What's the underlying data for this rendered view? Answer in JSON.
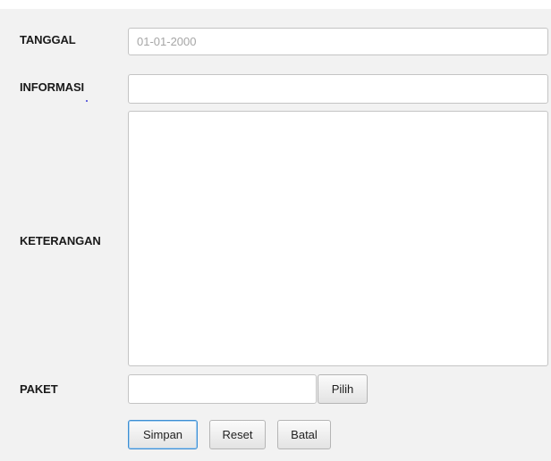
{
  "form": {
    "tanggal": {
      "label": "TANGGAL",
      "placeholder": "01-01-2000",
      "value": ""
    },
    "informasi": {
      "label": "INFORMASI",
      "value": ""
    },
    "keterangan": {
      "label": "KETERANGAN",
      "value": ""
    },
    "paket": {
      "label": "PAKET",
      "value": "",
      "pick_label": "Pilih"
    }
  },
  "actions": {
    "simpan": "Simpan",
    "reset": "Reset",
    "batal": "Batal"
  },
  "colors": {
    "focus_accent": "#3c8ed3"
  }
}
